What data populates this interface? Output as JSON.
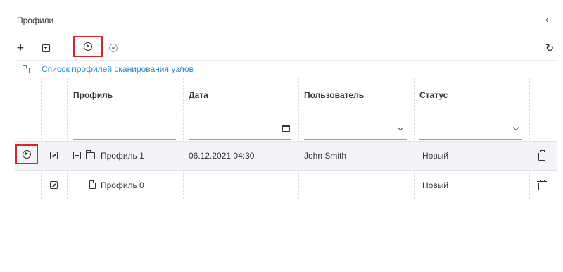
{
  "panel": {
    "title": "Профили",
    "collapse_icon": "chevron-left-icon"
  },
  "toolbar": {
    "buttons": [
      "plus-icon",
      "add-node-icon",
      "play-circle-icon",
      "stop-circle-icon",
      "refresh-icon"
    ]
  },
  "link": {
    "icon": "document-icon",
    "text": "Список профилей сканирования узлов"
  },
  "table": {
    "columns": [
      "Профиль",
      "Дата",
      "Пользователь",
      "Статус"
    ],
    "filters": {
      "date_icon": "calendar-icon",
      "user_icon": "chevron-down-icon",
      "status_icon": "chevron-down-icon"
    },
    "rows": [
      {
        "profile": "Профиль 1",
        "date": "06.12.2021 04:30",
        "user": "John Smith",
        "status": "Новый",
        "type": "folder",
        "expanded": true
      },
      {
        "profile": "Профиль 0",
        "date": "",
        "user": "",
        "status": "Новый",
        "type": "file"
      }
    ]
  },
  "colors": {
    "accent_link": "#1e8bd6",
    "highlight_box": "#e0202a",
    "row_highlight": "#f3f4f8"
  }
}
